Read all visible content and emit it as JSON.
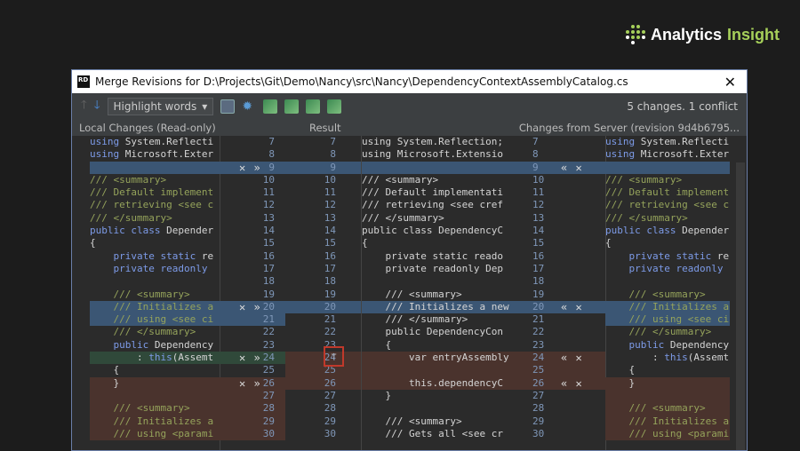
{
  "logo": {
    "text_a": "Analytics",
    "text_b": "Insight"
  },
  "window": {
    "title": "Merge Revisions for D:\\Projects\\Git\\Demo\\Nancy\\src\\Nancy\\DependencyContextAssemblyCatalog.cs",
    "app_icon": "RD",
    "close_icon": "✕"
  },
  "toolbar": {
    "highlight_mode": "Highlight words",
    "status": "5 changes. 1 conflict"
  },
  "headers": {
    "left": "Local Changes (Read-only)",
    "center": "Result",
    "right": "Changes from Server (revision 9d4b6795..."
  },
  "line_numbers": [
    7,
    8,
    9,
    10,
    11,
    12,
    13,
    14,
    15,
    16,
    17,
    18,
    19,
    20,
    21,
    22,
    23,
    24,
    25,
    26,
    27,
    28,
    29,
    30
  ],
  "left_code": [
    "using System.Reflecti",
    "using Microsoft.Exter",
    "",
    "/// <summary>",
    "/// Default implement",
    "/// retrieving <see c",
    "/// </summary>",
    "public class Depender",
    "{",
    "    private static re",
    "    private readonly ",
    "",
    "    /// <summary>",
    "    /// Initializes a",
    "    /// using <see ci",
    "    /// </summary>",
    "    public Dependency",
    "        : this(Assemt",
    "    {",
    "    }",
    "",
    "    /// <summary>",
    "    /// Initializes a",
    "    /// using <parami"
  ],
  "result_code": [
    "using System.Reflection;",
    "using Microsoft.Extensio",
    "",
    "/// <summary>",
    "/// Default implementati",
    "/// retrieving <see cref",
    "/// </summary>",
    "public class DependencyC",
    "{",
    "    private static reado",
    "    private readonly Dep",
    "",
    "    /// <summary>",
    "    /// Initializes a new",
    "    /// </summary>",
    "    public DependencyCon",
    "    {",
    "        var entryAssembly",
    "",
    "        this.dependencyC",
    "    }",
    "",
    "    /// <summary>",
    "    /// Gets all <see cr"
  ],
  "right_code": [
    "using System.Reflecti",
    "using Microsoft.Exter",
    "",
    "/// <summary>",
    "/// Default implement",
    "/// retrieving <see c",
    "/// </summary>",
    "public class Depender",
    "{",
    "    private static re",
    "    private readonly ",
    "",
    "    /// <summary>",
    "    /// Initializes a",
    "    /// using <see ci",
    "    /// </summary>",
    "    public Dependency",
    "        : this(Assemt",
    "    {",
    "    }",
    "",
    "    /// <summary>",
    "    /// Initializes a",
    "    /// using <parami"
  ],
  "left_changes": [
    {
      "lines": [
        9
      ],
      "type": "inserted"
    },
    {
      "lines": [
        20,
        21
      ],
      "type": "inserted"
    },
    {
      "lines": [
        24
      ],
      "type": "added"
    },
    {
      "lines": [
        26,
        27,
        28,
        29,
        30
      ],
      "type": "conflict"
    }
  ],
  "result_changes": [
    {
      "lines": [
        9
      ],
      "type": "inserted"
    },
    {
      "lines": [
        20
      ],
      "type": "inserted"
    },
    {
      "lines": [
        24,
        25,
        26
      ],
      "type": "conflict"
    }
  ],
  "right_changes": [
    {
      "lines": [
        9
      ],
      "type": "inserted"
    },
    {
      "lines": [
        20,
        21
      ],
      "type": "inserted"
    },
    {
      "lines": [
        26,
        27,
        28,
        29,
        30
      ],
      "type": "conflict"
    }
  ],
  "left_actions": {
    "lines": [
      9,
      20,
      24,
      26
    ],
    "label": "✕ »"
  },
  "right_actions": {
    "lines": [
      9,
      20,
      24,
      26
    ],
    "label": "« ✕"
  },
  "colors": {
    "inserted": "#3b5674",
    "added": "#30493a",
    "conflict": "#4a332d",
    "keyword": "#7d9be8",
    "comment": "#95a35b"
  }
}
